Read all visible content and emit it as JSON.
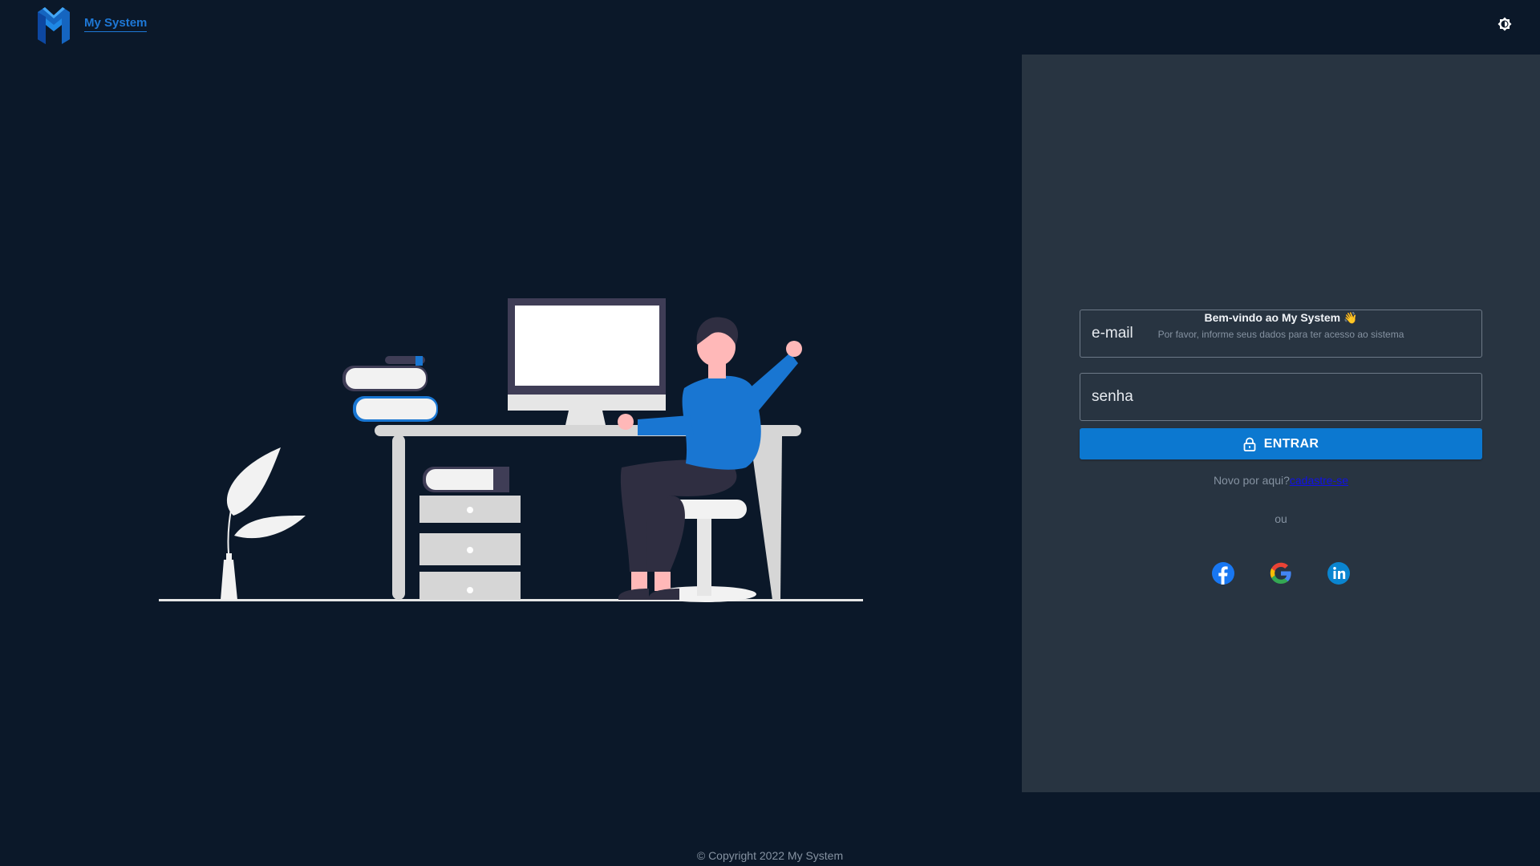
{
  "header": {
    "brand_name": "My System",
    "logo_icon": "m-logo-icon",
    "theme_toggle_icon": "brightness-icon"
  },
  "login": {
    "welcome_text": "Bem-vindo ao My System",
    "welcome_emoji": "👋",
    "subtitle": "Por favor, informe seus dados para ter acesso ao sistema",
    "email_placeholder": "e-mail",
    "password_placeholder": "senha",
    "submit_label": "ENTRAR",
    "submit_icon": "lock-icon",
    "signup_prompt": "Novo por aqui?",
    "signup_link": "cadastre-se",
    "or_text": "ou",
    "social": [
      {
        "name": "facebook",
        "icon": "facebook-icon"
      },
      {
        "name": "google",
        "icon": "google-icon"
      },
      {
        "name": "linkedin",
        "icon": "linkedin-icon"
      }
    ]
  },
  "footer": {
    "copyright": "© Copyright 2022 My System"
  },
  "colors": {
    "background": "#0b1829",
    "panel": "#283441",
    "accent": "#0c78d0",
    "brand": "#1e78d6",
    "link": "#1010e8"
  }
}
